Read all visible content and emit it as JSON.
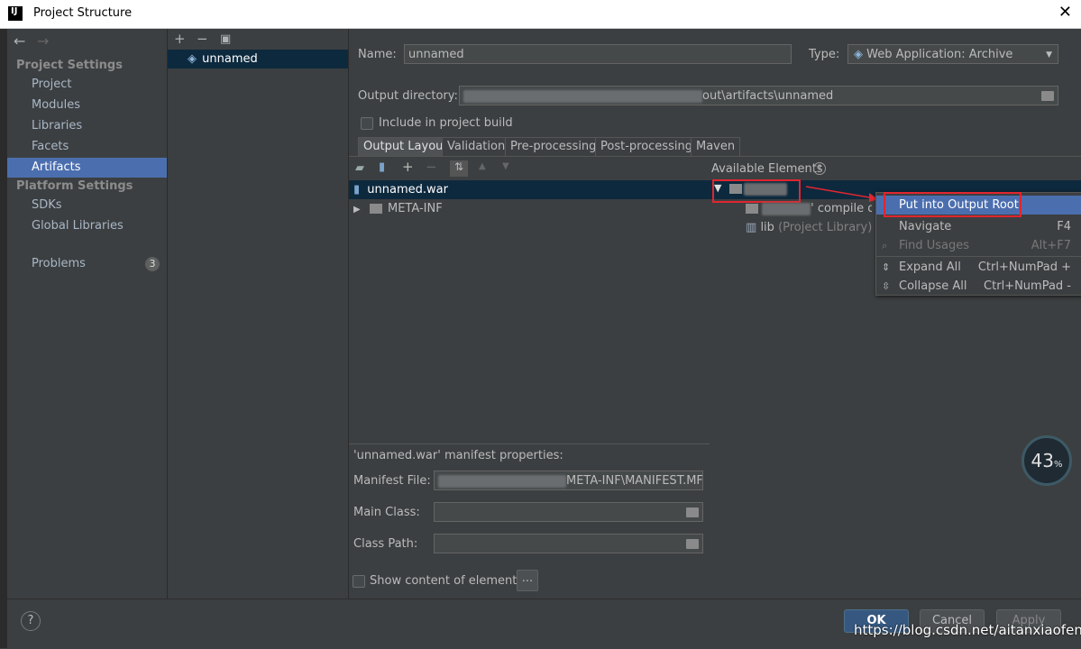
{
  "window": {
    "title": "Project Structure"
  },
  "nav": {
    "project_settings": "Project Settings",
    "project_items": [
      "Project",
      "Modules",
      "Libraries",
      "Facets",
      "Artifacts"
    ],
    "platform_settings": "Platform Settings",
    "platform_items": [
      "SDKs",
      "Global Libraries"
    ],
    "problems": "Problems",
    "problems_count": "3"
  },
  "artifacts": {
    "items": [
      "unnamed"
    ]
  },
  "form": {
    "name_label": "Name:",
    "name_value": "unnamed",
    "type_label": "Type:",
    "type_value": "Web Application: Archive",
    "output_dir_label": "Output directory:",
    "output_dir_value": "out\\artifacts\\unnamed",
    "include_label": "Include in project build"
  },
  "tabs": [
    "Output Layout",
    "Validation",
    "Pre-processing",
    "Post-processing",
    "Maven"
  ],
  "layout": {
    "available_label": "Available Elements",
    "root_item": "unnamed.war",
    "meta_inf": "META-INF",
    "avail_compile": "' compile ou",
    "avail_lib": "lib",
    "avail_lib_suffix": "(Project Library)"
  },
  "context_menu": {
    "items": [
      {
        "label": "Put into Output Root",
        "shortcut": ""
      },
      {
        "label": "Navigate",
        "shortcut": "F4"
      },
      {
        "label": "Find Usages",
        "shortcut": "Alt+F7"
      },
      {
        "label": "Expand All",
        "shortcut": "Ctrl+NumPad +"
      },
      {
        "label": "Collapse All",
        "shortcut": "Ctrl+NumPad -"
      }
    ]
  },
  "manifest": {
    "title": "'unnamed.war' manifest properties:",
    "file_label": "Manifest File:",
    "file_value": "META-INF\\MANIFEST.MF",
    "main_class_label": "Main Class:",
    "class_path_label": "Class Path:",
    "show_content_label": "Show content of elements",
    "ellipsis": "..."
  },
  "buttons": {
    "ok": "OK",
    "cancel": "Cancel",
    "apply": "Apply",
    "help": "?"
  },
  "overlay": {
    "gauge": "43",
    "gauge_unit": "%",
    "watermark": "https://blog.csdn.net/aitanxiaofeng"
  },
  "colors": {
    "accent": "#4b6eaf",
    "highlight_box": "#e0262f"
  }
}
